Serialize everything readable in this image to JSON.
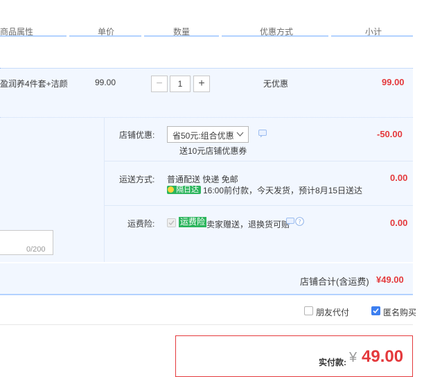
{
  "header": {
    "col_attr": "商品属性",
    "col_price": "单价",
    "col_qty": "数量",
    "col_discount": "优惠方式",
    "col_subtotal": "小计"
  },
  "item": {
    "name": "盈润养4件套+洁颜",
    "price": "99.00",
    "quantity": "1",
    "discount": "无优惠",
    "subtotal": "99.00"
  },
  "shop_discount": {
    "label": "店铺优惠:",
    "selected": "省50元:组合优惠",
    "note": "送10元店铺优惠券",
    "amount": "-50.00"
  },
  "shipping": {
    "label": "运送方式:",
    "method": "普通配送 快递 免邮",
    "badge": "隔日达",
    "info": "16:00前付款，今天发货，预计8月15日送达",
    "amount": "0.00"
  },
  "insurance": {
    "label": "运费险:",
    "tag": "运费险",
    "text": "卖家赠送，退换货可赔",
    "amount": "0.00"
  },
  "message": {
    "counter": "0/200"
  },
  "store_total": {
    "label": "店铺合计(含运费)",
    "amount": "¥49.00"
  },
  "options": {
    "friend_pay": "朋友代付",
    "anonymous": "匿名购买"
  },
  "payment": {
    "label": "实付款:",
    "currency": "¥",
    "amount": "49.00"
  },
  "colors": {
    "accent": "#3d7ff0",
    "price_red": "#e4393c",
    "panel_bg": "#f2f7ff",
    "badge_green": "#2db55d"
  }
}
